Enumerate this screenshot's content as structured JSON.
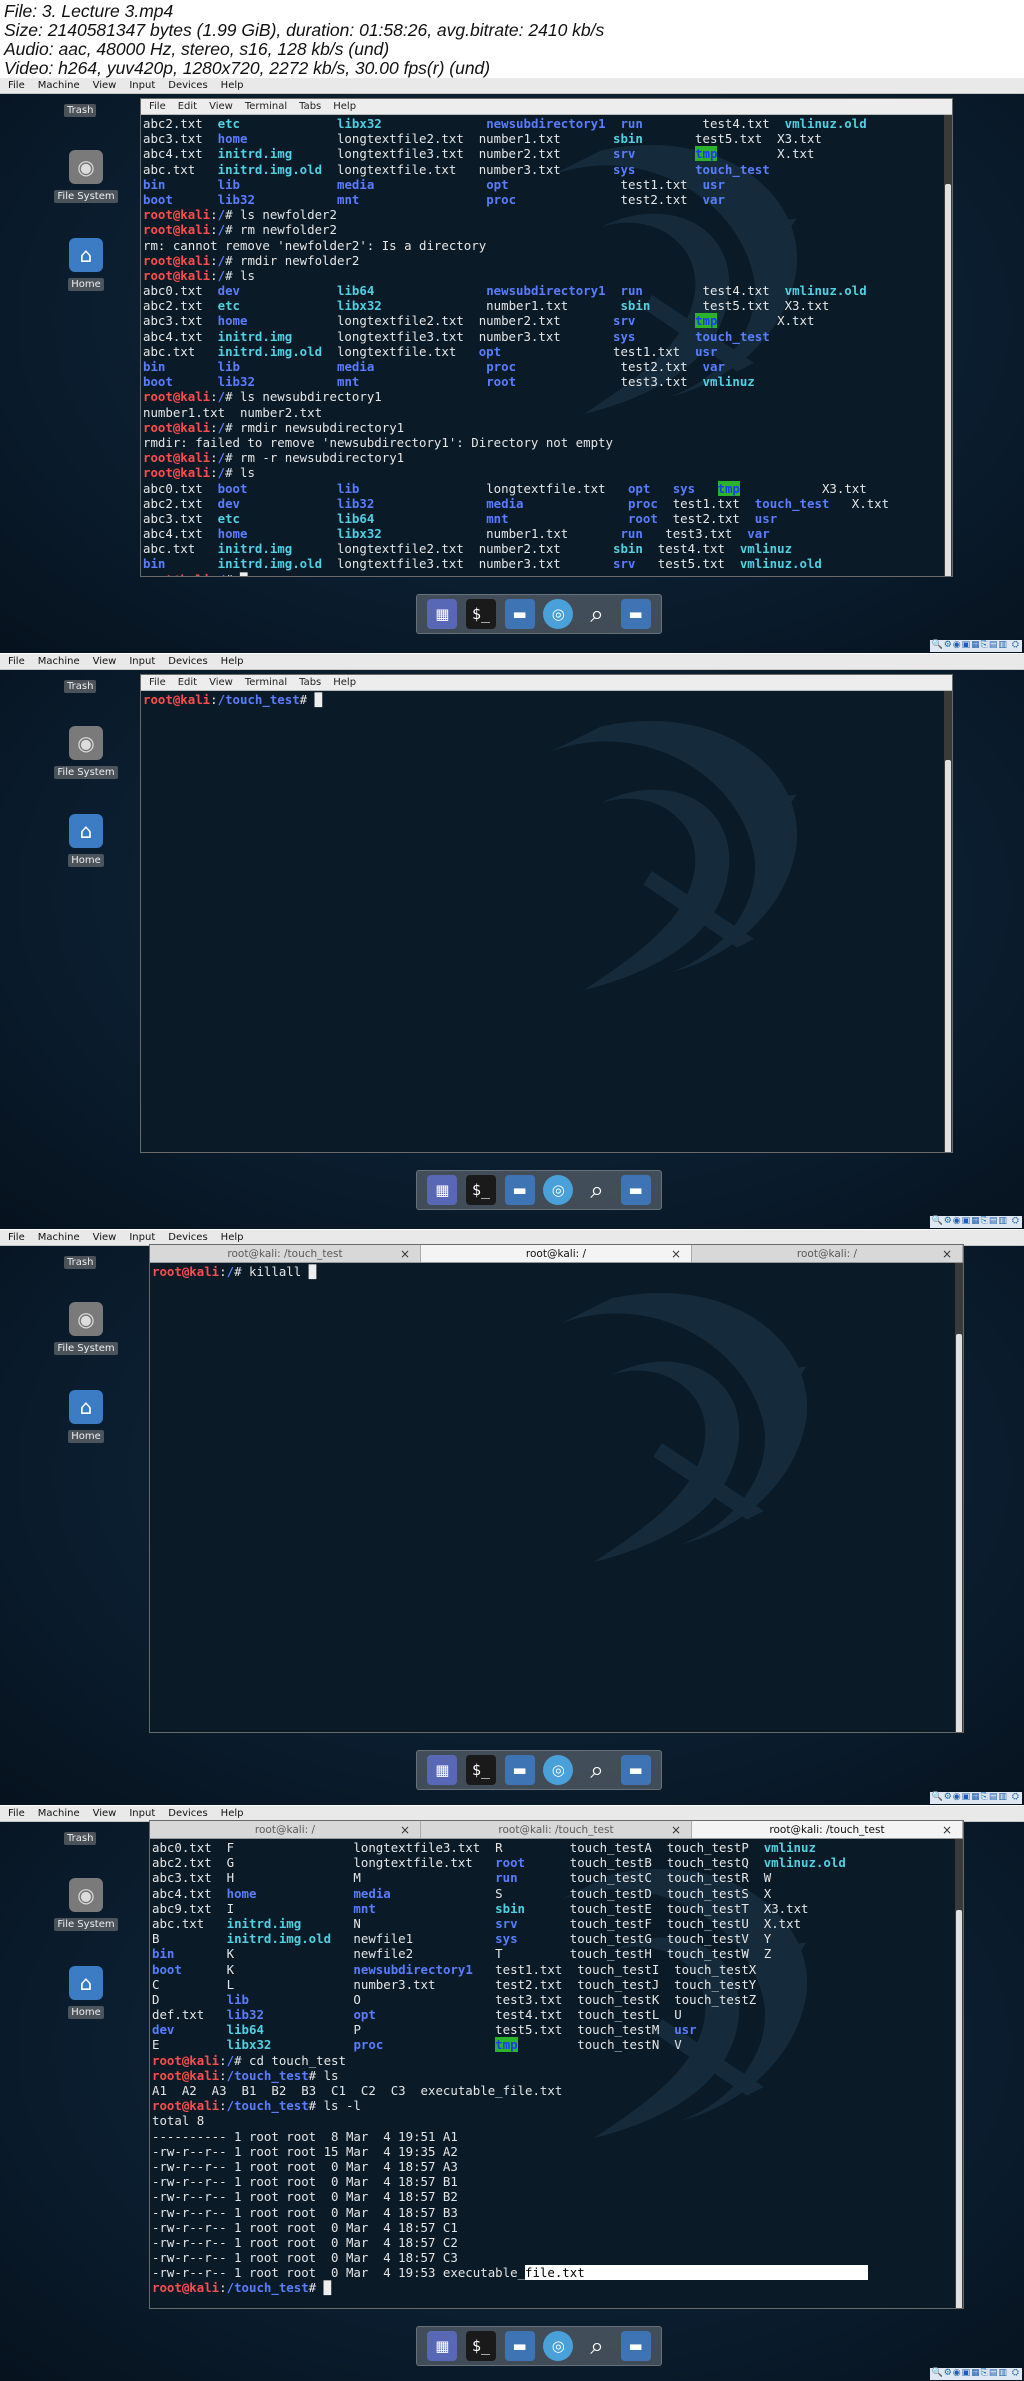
{
  "info": {
    "lines": [
      "File: 3. Lecture 3.mp4",
      "Size: 2140581347 bytes (1.99 GiB), duration: 01:58:26, avg.bitrate: 2410 kb/s",
      "Audio: aac, 48000 Hz, stereo, s16, 128 kb/s (und)",
      "Video: h264, yuv420p, 1280x720, 2272 kb/s, 30.00 fps(r) (und)"
    ]
  },
  "vbox_menu": [
    "File",
    "Machine",
    "View",
    "Input",
    "Devices",
    "Help"
  ],
  "terminal_menu": [
    "File",
    "Edit",
    "View",
    "Terminal",
    "Tabs",
    "Help"
  ],
  "desktop_icons": {
    "trash": "Trash",
    "filesystem": "File System",
    "home": "Home"
  },
  "panel1": {
    "lines": [
      [
        [
          "abc2.txt  ",
          ""
        ],
        [
          "etc",
          "c"
        ],
        [
          "             ",
          ""
        ],
        [
          "libx32",
          "c"
        ],
        [
          "              ",
          ""
        ],
        [
          "newsubdirectory1",
          "p"
        ],
        [
          "  ",
          ""
        ],
        [
          "run",
          "p"
        ],
        [
          "        test4.txt  ",
          ""
        ],
        [
          "vmlinuz.old",
          "c"
        ]
      ],
      [
        [
          "abc3.txt  ",
          ""
        ],
        [
          "home",
          "p"
        ],
        [
          "            longtextfile2.txt  number1.txt       ",
          ""
        ],
        [
          "sbin",
          "c"
        ],
        [
          "       test5.txt  X3.txt",
          ""
        ]
      ],
      [
        [
          "abc4.txt  ",
          ""
        ],
        [
          "initrd.img",
          "c"
        ],
        [
          "      longtextfile3.txt  number2.txt       ",
          ""
        ],
        [
          "srv",
          "p"
        ],
        [
          "        ",
          ""
        ],
        [
          "tmp",
          "g"
        ],
        [
          "        X.txt",
          ""
        ]
      ],
      [
        [
          "abc.txt   ",
          ""
        ],
        [
          "initrd.img.old",
          "c"
        ],
        [
          "  longtextfile.txt   number3.txt       ",
          ""
        ],
        [
          "sys",
          "p"
        ],
        [
          "        ",
          ""
        ],
        [
          "touch_test",
          "p"
        ]
      ],
      [
        [
          "bin",
          "p"
        ],
        [
          "       ",
          ""
        ],
        [
          "lib",
          "p"
        ],
        [
          "             ",
          ""
        ],
        [
          "media",
          "p"
        ],
        [
          "               ",
          ""
        ],
        [
          "opt",
          "p"
        ],
        [
          "               test1.txt  ",
          ""
        ],
        [
          "usr",
          "p"
        ]
      ],
      [
        [
          "boot",
          "p"
        ],
        [
          "      ",
          ""
        ],
        [
          "lib32",
          "p"
        ],
        [
          "           ",
          ""
        ],
        [
          "mnt",
          "p"
        ],
        [
          "                 ",
          ""
        ],
        [
          "proc",
          "p"
        ],
        [
          "              test2.txt  ",
          ""
        ],
        [
          "var",
          "p"
        ]
      ],
      [
        [
          "root@kali",
          "r"
        ],
        [
          ":",
          ""
        ],
        [
          "/",
          "p"
        ],
        [
          "# ls newfolder2",
          ""
        ]
      ],
      [
        [
          "root@kali",
          "r"
        ],
        [
          ":",
          ""
        ],
        [
          "/",
          "p"
        ],
        [
          "# rm newfolder2",
          ""
        ]
      ],
      [
        [
          "rm: cannot remove 'newfolder2': Is a directory",
          ""
        ]
      ],
      [
        [
          "root@kali",
          "r"
        ],
        [
          ":",
          ""
        ],
        [
          "/",
          "p"
        ],
        [
          "# rmdir newfolder2",
          ""
        ]
      ],
      [
        [
          "root@kali",
          "r"
        ],
        [
          ":",
          ""
        ],
        [
          "/",
          "p"
        ],
        [
          "# ls",
          ""
        ]
      ],
      [
        [
          "abc0.txt  ",
          ""
        ],
        [
          "dev",
          "p"
        ],
        [
          "             ",
          ""
        ],
        [
          "lib64",
          "c"
        ],
        [
          "               ",
          ""
        ],
        [
          "newsubdirectory1",
          "p"
        ],
        [
          "  ",
          ""
        ],
        [
          "run",
          "p"
        ],
        [
          "        test4.txt  ",
          ""
        ],
        [
          "vmlinuz.old",
          "c"
        ]
      ],
      [
        [
          "abc2.txt  ",
          ""
        ],
        [
          "etc",
          "c"
        ],
        [
          "             ",
          ""
        ],
        [
          "libx32",
          "c"
        ],
        [
          "              number1.txt       ",
          ""
        ],
        [
          "sbin",
          "c"
        ],
        [
          "       test5.txt  X3.txt",
          ""
        ]
      ],
      [
        [
          "abc3.txt  ",
          ""
        ],
        [
          "home",
          "p"
        ],
        [
          "            longtextfile2.txt  number2.txt       ",
          ""
        ],
        [
          "srv",
          "p"
        ],
        [
          "        ",
          ""
        ],
        [
          "tmp",
          "g"
        ],
        [
          "        X.txt",
          ""
        ]
      ],
      [
        [
          "abc4.txt  ",
          ""
        ],
        [
          "initrd.img",
          "c"
        ],
        [
          "      longtextfile3.txt  number3.txt       ",
          ""
        ],
        [
          "sys",
          "p"
        ],
        [
          "        ",
          ""
        ],
        [
          "touch_test",
          "p"
        ]
      ],
      [
        [
          "abc.txt   ",
          ""
        ],
        [
          "initrd.img.old",
          "c"
        ],
        [
          "  longtextfile.txt   ",
          ""
        ],
        [
          "opt",
          "p"
        ],
        [
          "               test1.txt  ",
          ""
        ],
        [
          "usr",
          "p"
        ]
      ],
      [
        [
          "bin",
          "p"
        ],
        [
          "       ",
          ""
        ],
        [
          "lib",
          "p"
        ],
        [
          "             ",
          ""
        ],
        [
          "media",
          "p"
        ],
        [
          "               ",
          ""
        ],
        [
          "proc",
          "p"
        ],
        [
          "              test2.txt  ",
          ""
        ],
        [
          "var",
          "p"
        ]
      ],
      [
        [
          "boot",
          "p"
        ],
        [
          "      ",
          ""
        ],
        [
          "lib32",
          "p"
        ],
        [
          "           ",
          ""
        ],
        [
          "mnt",
          "p"
        ],
        [
          "                 ",
          ""
        ],
        [
          "root",
          "p"
        ],
        [
          "              test3.txt  ",
          ""
        ],
        [
          "vmlinuz",
          "c"
        ]
      ],
      [
        [
          "root@kali",
          "r"
        ],
        [
          ":",
          ""
        ],
        [
          "/",
          "p"
        ],
        [
          "# ls newsubdirectory1",
          ""
        ]
      ],
      [
        [
          "number1.txt  number2.txt",
          ""
        ]
      ],
      [
        [
          "root@kali",
          "r"
        ],
        [
          ":",
          ""
        ],
        [
          "/",
          "p"
        ],
        [
          "# rmdir newsubdirectory1",
          ""
        ]
      ],
      [
        [
          "rmdir: failed to remove 'newsubdirectory1': Directory not empty",
          ""
        ]
      ],
      [
        [
          "root@kali",
          "r"
        ],
        [
          ":",
          ""
        ],
        [
          "/",
          "p"
        ],
        [
          "# rm -r newsubdirectory1",
          ""
        ]
      ],
      [
        [
          "root@kali",
          "r"
        ],
        [
          ":",
          ""
        ],
        [
          "/",
          "p"
        ],
        [
          "# ls",
          ""
        ]
      ],
      [
        [
          "abc0.txt  ",
          ""
        ],
        [
          "boot",
          "p"
        ],
        [
          "            ",
          ""
        ],
        [
          "lib",
          "p"
        ],
        [
          "                 longtextfile.txt   ",
          ""
        ],
        [
          "opt",
          "p"
        ],
        [
          "   ",
          ""
        ],
        [
          "sys",
          "p"
        ],
        [
          "   ",
          ""
        ],
        [
          "tmp",
          "g"
        ],
        [
          "           X3.txt",
          ""
        ]
      ],
      [
        [
          "abc2.txt  ",
          ""
        ],
        [
          "dev",
          "p"
        ],
        [
          "             ",
          ""
        ],
        [
          "lib32",
          "p"
        ],
        [
          "               ",
          ""
        ],
        [
          "media",
          "p"
        ],
        [
          "              ",
          ""
        ],
        [
          "proc",
          "p"
        ],
        [
          "  test1.txt  ",
          ""
        ],
        [
          "touch_test",
          "p"
        ],
        [
          "   X.txt",
          ""
        ]
      ],
      [
        [
          "abc3.txt  ",
          ""
        ],
        [
          "etc",
          "c"
        ],
        [
          "             ",
          ""
        ],
        [
          "lib64",
          "c"
        ],
        [
          "               ",
          ""
        ],
        [
          "mnt",
          "p"
        ],
        [
          "                ",
          ""
        ],
        [
          "root",
          "p"
        ],
        [
          "  test2.txt  ",
          ""
        ],
        [
          "usr",
          "p"
        ]
      ],
      [
        [
          "abc4.txt  ",
          ""
        ],
        [
          "home",
          "p"
        ],
        [
          "            ",
          ""
        ],
        [
          "libx32",
          "c"
        ],
        [
          "              number1.txt       ",
          ""
        ],
        [
          "run",
          "p"
        ],
        [
          "   test3.txt  ",
          ""
        ],
        [
          "var",
          "p"
        ]
      ],
      [
        [
          "abc.txt   ",
          ""
        ],
        [
          "initrd.img",
          "c"
        ],
        [
          "      longtextfile2.txt  number2.txt       ",
          ""
        ],
        [
          "sbin",
          "c"
        ],
        [
          "  test4.txt  ",
          ""
        ],
        [
          "vmlinuz",
          "c"
        ]
      ],
      [
        [
          "bin",
          "p"
        ],
        [
          "       ",
          ""
        ],
        [
          "initrd.img.old",
          "c"
        ],
        [
          "  longtextfile3.txt  number3.txt       ",
          ""
        ],
        [
          "srv",
          "p"
        ],
        [
          "   test5.txt  ",
          ""
        ],
        [
          "vmlinuz.old",
          "c"
        ]
      ],
      [
        [
          "root@kali",
          "r"
        ],
        [
          ":",
          ""
        ],
        [
          "/",
          "p"
        ],
        [
          "# ",
          ""
        ]
      ]
    ]
  },
  "panel2": {
    "lines": [
      [
        [
          "root@kali",
          "r"
        ],
        [
          ":",
          ""
        ],
        [
          "/touch_test",
          "p"
        ],
        [
          "# ",
          ""
        ]
      ]
    ]
  },
  "panel3": {
    "tabs": [
      "root@kali: /touch_test",
      "root@kali: /",
      "root@kali: /"
    ],
    "lines": [
      [
        [
          "root@kali",
          "r"
        ],
        [
          ":",
          ""
        ],
        [
          "/",
          "p"
        ],
        [
          "# killall ",
          ""
        ]
      ]
    ]
  },
  "panel4": {
    "tabs": [
      "root@kali: /",
      "root@kali: /touch_test",
      "root@kali: /touch_test"
    ],
    "lines": [
      [
        [
          "abc0.txt  F                longtextfile3.txt  R         touch_testA  touch_testP  ",
          ""
        ],
        [
          "vmlinuz",
          "c"
        ]
      ],
      [
        [
          "abc2.txt  G                longtextfile.txt   ",
          ""
        ],
        [
          "root",
          "p"
        ],
        [
          "      touch_testB  touch_testQ  ",
          ""
        ],
        [
          "vmlinuz.old",
          "c"
        ]
      ],
      [
        [
          "abc3.txt  H                M                  ",
          ""
        ],
        [
          "run",
          "p"
        ],
        [
          "       touch_testC  touch_testR  W",
          ""
        ]
      ],
      [
        [
          "abc4.txt  ",
          ""
        ],
        [
          "home",
          "p"
        ],
        [
          "             ",
          ""
        ],
        [
          "media",
          "p"
        ],
        [
          "              S         touch_testD  touch_testS  X",
          ""
        ]
      ],
      [
        [
          "abc9.txt  I                ",
          ""
        ],
        [
          "mnt",
          "p"
        ],
        [
          "                ",
          ""
        ],
        [
          "sbin",
          "c"
        ],
        [
          "      touch_testE  touch_testT  X3.txt",
          ""
        ]
      ],
      [
        [
          "abc.txt   ",
          ""
        ],
        [
          "initrd.img",
          "c"
        ],
        [
          "       N                  ",
          ""
        ],
        [
          "srv",
          "p"
        ],
        [
          "       touch_testF  touch_testU  X.txt",
          ""
        ]
      ],
      [
        [
          "B         ",
          ""
        ],
        [
          "initrd.img.old",
          "c"
        ],
        [
          "   newfile1           ",
          ""
        ],
        [
          "sys",
          "p"
        ],
        [
          "       touch_testG  touch_testV  Y",
          ""
        ]
      ],
      [
        [
          "bin",
          "p"
        ],
        [
          "       K                newfile2           T         touch_testH  touch_testW  Z",
          ""
        ]
      ],
      [
        [
          "boot",
          "p"
        ],
        [
          "      K                ",
          ""
        ],
        [
          "newsubdirectory1",
          "p"
        ],
        [
          "   test1.txt  touch_testI  touch_testX",
          ""
        ]
      ],
      [
        [
          "C         L                number3.txt        test2.txt  touch_testJ  touch_testY",
          ""
        ]
      ],
      [
        [
          "D         ",
          ""
        ],
        [
          "lib",
          "p"
        ],
        [
          "              O                  test3.txt  touch_testK  touch_testZ",
          ""
        ]
      ],
      [
        [
          "def.txt   ",
          ""
        ],
        [
          "lib32",
          "p"
        ],
        [
          "            ",
          ""
        ],
        [
          "opt",
          "p"
        ],
        [
          "                test4.txt  touch_testL  U",
          ""
        ]
      ],
      [
        [
          "dev",
          "p"
        ],
        [
          "       ",
          ""
        ],
        [
          "lib64",
          "c"
        ],
        [
          "            P                  test5.txt  touch_testM  ",
          ""
        ],
        [
          "usr",
          "p"
        ]
      ],
      [
        [
          "E         ",
          ""
        ],
        [
          "libx32",
          "c"
        ],
        [
          "           ",
          ""
        ],
        [
          "proc",
          "p"
        ],
        [
          "               ",
          ""
        ],
        [
          "tmp",
          "g"
        ],
        [
          "        touch_testN  V",
          ""
        ]
      ],
      [
        [
          "root@kali",
          "r"
        ],
        [
          ":",
          ""
        ],
        [
          "/",
          "p"
        ],
        [
          "# cd touch_test",
          ""
        ]
      ],
      [
        [
          "root@kali",
          "r"
        ],
        [
          ":",
          ""
        ],
        [
          "/touch_test",
          "p"
        ],
        [
          "# ls",
          ""
        ]
      ],
      [
        [
          "A1  A2  A3  B1  B2  B3  C1  C2  C3  executable_file.txt",
          ""
        ]
      ],
      [
        [
          "root@kali",
          "r"
        ],
        [
          ":",
          ""
        ],
        [
          "/touch_test",
          "p"
        ],
        [
          "# ls -l",
          ""
        ]
      ],
      [
        [
          "total 8",
          ""
        ]
      ],
      [
        [
          "---------- 1 root root  8 Mar  4 19:51 A1",
          ""
        ]
      ],
      [
        [
          "-rw-r--r-- 1 root root 15 Mar  4 19:35 A2",
          ""
        ]
      ],
      [
        [
          "-rw-r--r-- 1 root root  0 Mar  4 18:57 A3",
          ""
        ]
      ],
      [
        [
          "-rw-r--r-- 1 root root  0 Mar  4 18:57 B1",
          ""
        ]
      ],
      [
        [
          "-rw-r--r-- 1 root root  0 Mar  4 18:57 B2",
          ""
        ]
      ],
      [
        [
          "-rw-r--r-- 1 root root  0 Mar  4 18:57 B3",
          ""
        ]
      ],
      [
        [
          "-rw-r--r-- 1 root root  0 Mar  4 18:57 C1",
          ""
        ]
      ],
      [
        [
          "-rw-r--r-- 1 root root  0 Mar  4 18:57 C2",
          ""
        ]
      ],
      [
        [
          "-rw-r--r-- 1 root root  0 Mar  4 18:57 C3",
          ""
        ]
      ],
      [
        [
          "-rw-r--r-- 1 root root  0 Mar  4 19:53 executable_",
          ""
        ],
        [
          "file.txt                                      ",
          "hl"
        ]
      ],
      [
        [
          "root@kali",
          "r"
        ],
        [
          ":",
          ""
        ],
        [
          "/touch_test",
          "p"
        ],
        [
          "# ",
          ""
        ]
      ]
    ]
  },
  "dock_icons": [
    "workspace-icon",
    "terminal-icon",
    "files-icon",
    "browser-icon",
    "search-icon",
    "folder-icon"
  ],
  "status_icons": "🔍⚙◉▣▦⎘▤▥ ⛭",
  "colors": {
    "prompt": "#ff4d4d",
    "dir": "#5a7dff",
    "link": "#4fd1e2",
    "sticky_bg": "#2bb32b",
    "terminal_bg": "#0a1a27"
  }
}
